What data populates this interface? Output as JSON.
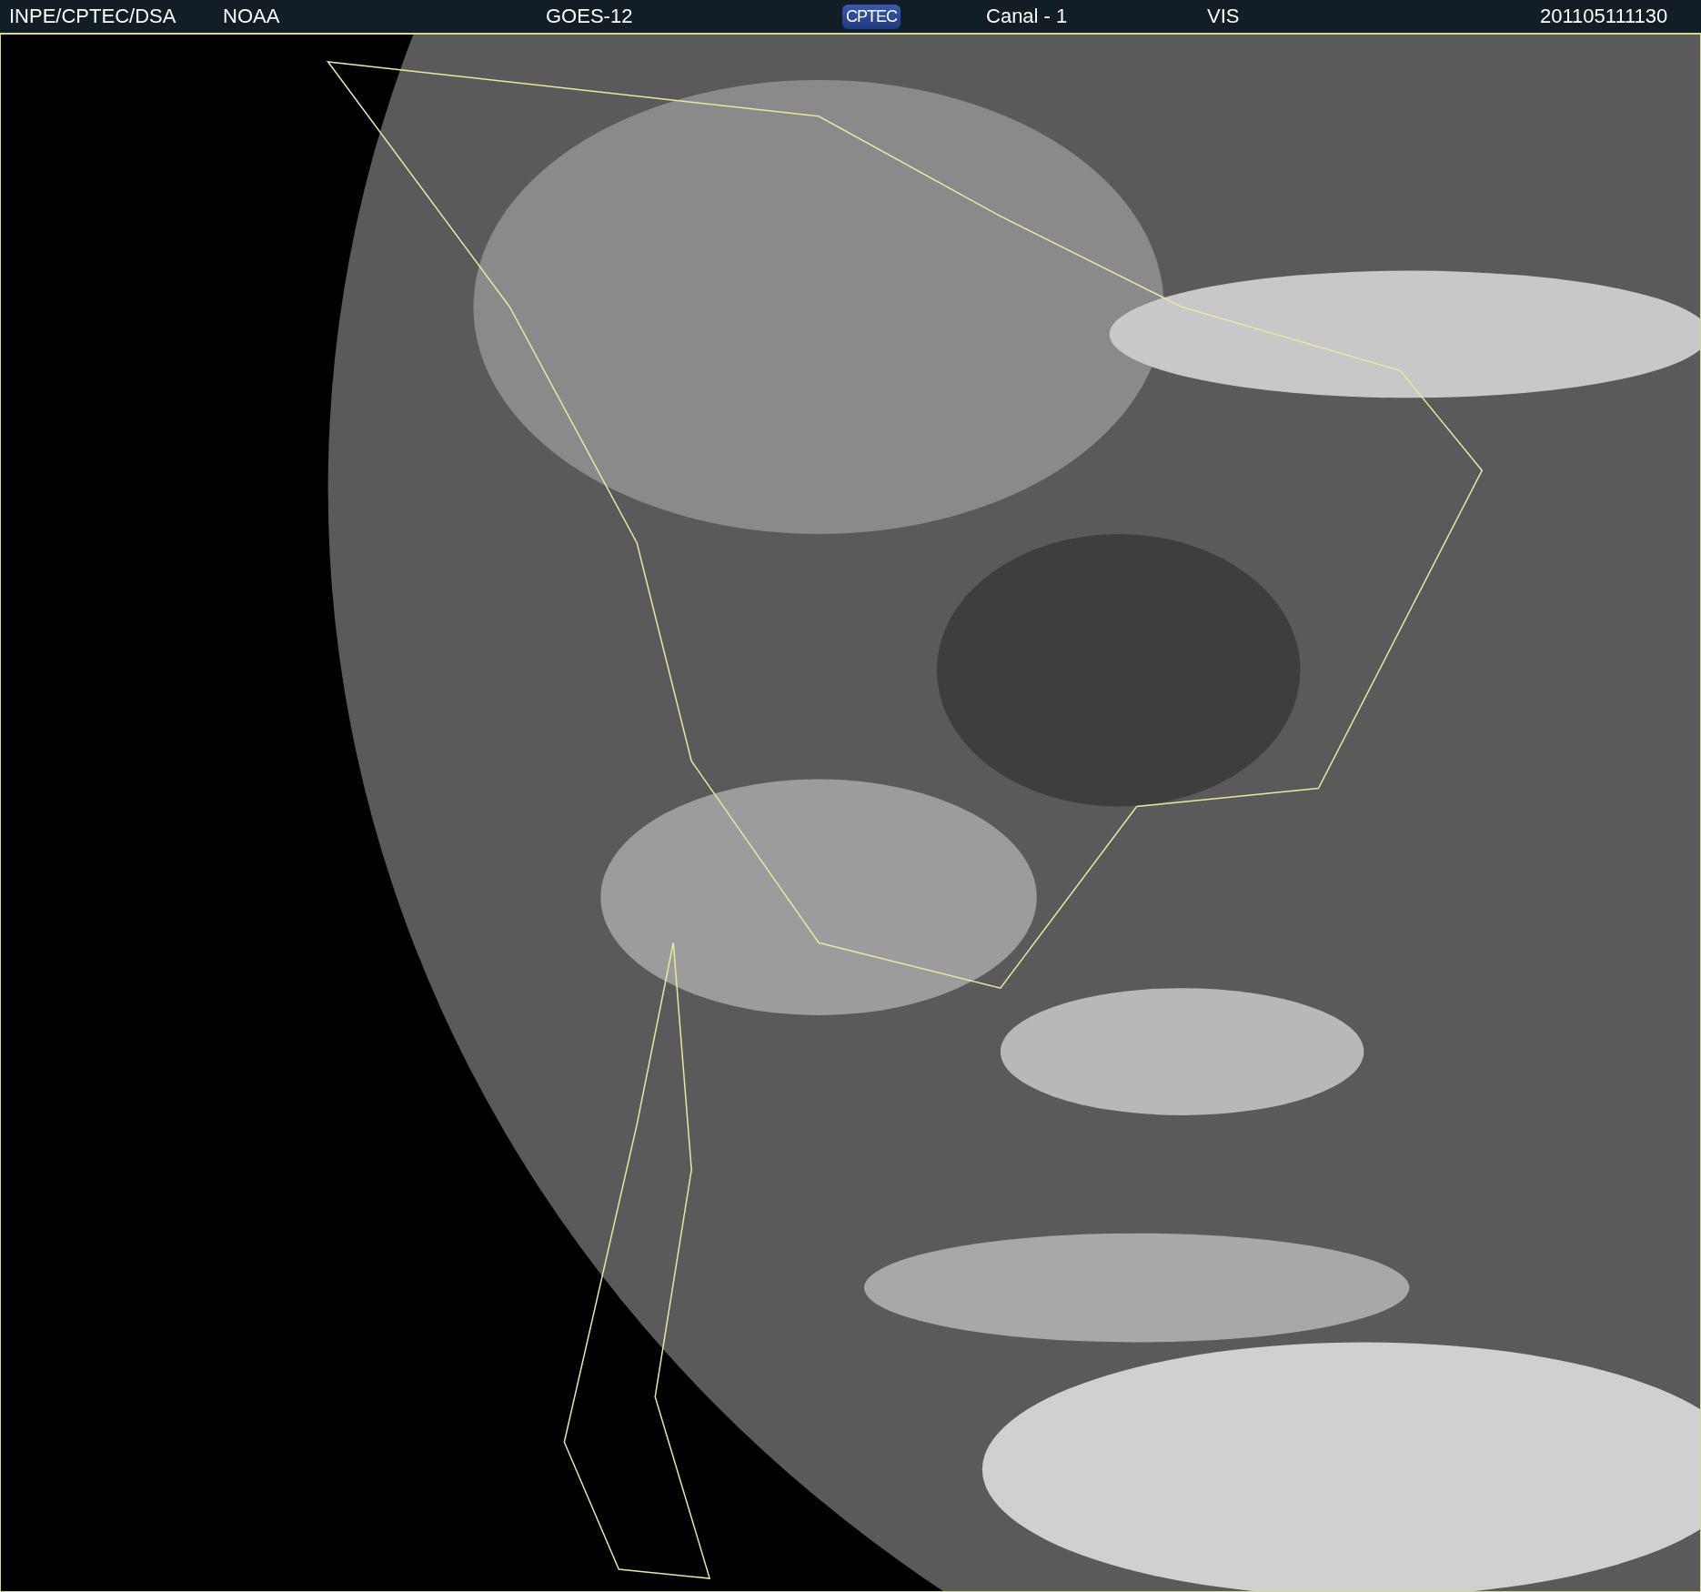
{
  "header": {
    "source": "INPE/CPTEC/DSA",
    "agency": "NOAA",
    "satellite": "GOES-12",
    "logo": "CPTEC",
    "channel": "Canal - 1",
    "band": "VIS",
    "timestamp": "201105111130"
  }
}
